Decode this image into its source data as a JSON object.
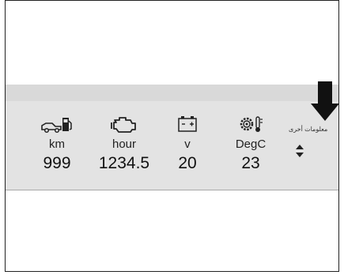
{
  "panel": {
    "more_info_label": "معلومات أخرى",
    "readings": [
      {
        "icon": "fuel-car-icon",
        "unit": "km",
        "value": "999"
      },
      {
        "icon": "engine-icon",
        "unit": "hour",
        "value": "1234.5"
      },
      {
        "icon": "battery-icon",
        "unit": "v",
        "value": "20"
      },
      {
        "icon": "temperature-gear-icon",
        "unit": "DegC",
        "value": "23"
      }
    ]
  },
  "colors": {
    "panel_bg": "#e3e3e3",
    "strip_bg": "#d9d9d9",
    "arrow": "#111111"
  }
}
